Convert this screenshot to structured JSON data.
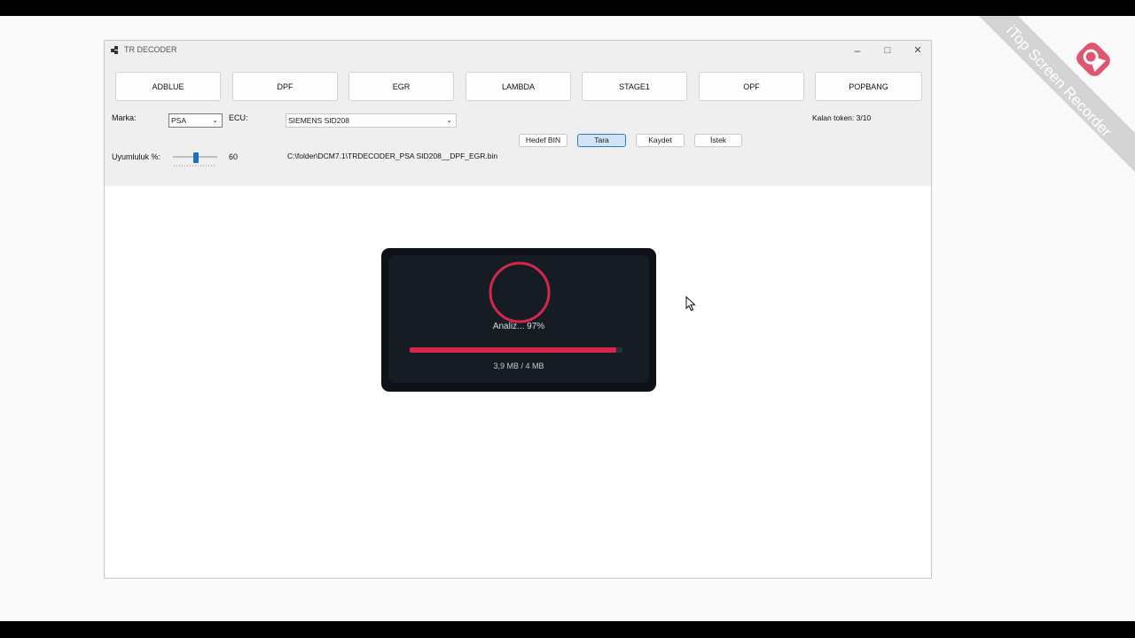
{
  "window": {
    "title": "TR DECODER",
    "minimize": "–",
    "maximize": "□",
    "close": "✕"
  },
  "modes": [
    "ADBLUE",
    "DPF",
    "EGR",
    "LAMBDA",
    "STAGE1",
    "OPF",
    "POPBANG"
  ],
  "form": {
    "brand_label": "Marka:",
    "brand_value": "PSA",
    "ecu_label": "ECU:",
    "ecu_value": "SIEMENS SID208",
    "compat_label": "Uyumluluk %:",
    "compat_value": "60",
    "compat_level": 60,
    "file_path": "C:\\folder\\DCM7.1\\TRDECODER_PSA SID208__DPF_EGR.bin"
  },
  "actions": {
    "target_bin": "Hedef BIN",
    "scan": "Tara",
    "save": "Kaydet",
    "request": "İstek"
  },
  "token_text": "Kalan token: 3/10",
  "loader": {
    "status": "Analiz... 97%",
    "progress": 0.97,
    "size_text": "3,9 MB / 4 MB",
    "accent_color": "#d6274a"
  },
  "watermark": {
    "text": "iTop Screen Recorder",
    "logo_icon": "itop-recorder-logo"
  }
}
